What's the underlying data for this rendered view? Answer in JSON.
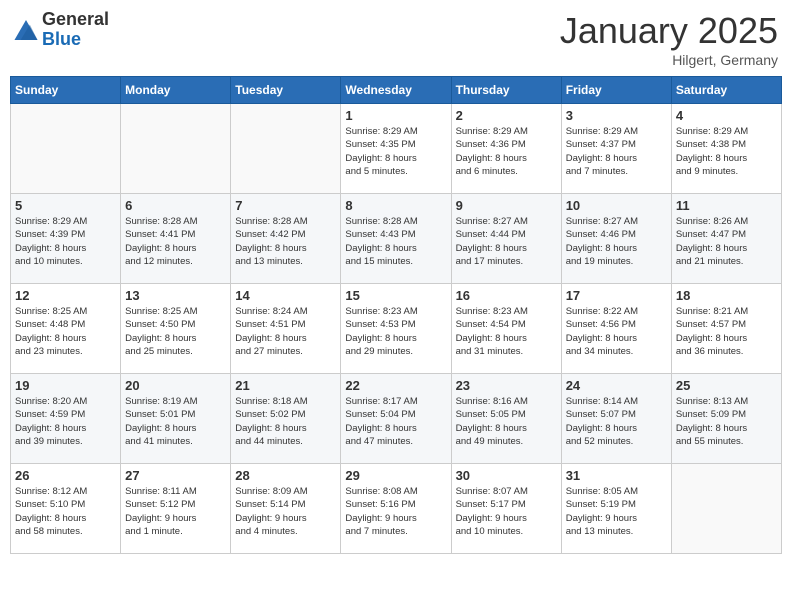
{
  "header": {
    "logo_general": "General",
    "logo_blue": "Blue",
    "month_title": "January 2025",
    "location": "Hilgert, Germany"
  },
  "weekdays": [
    "Sunday",
    "Monday",
    "Tuesday",
    "Wednesday",
    "Thursday",
    "Friday",
    "Saturday"
  ],
  "weeks": [
    [
      {
        "day": "",
        "info": ""
      },
      {
        "day": "",
        "info": ""
      },
      {
        "day": "",
        "info": ""
      },
      {
        "day": "1",
        "info": "Sunrise: 8:29 AM\nSunset: 4:35 PM\nDaylight: 8 hours\nand 5 minutes."
      },
      {
        "day": "2",
        "info": "Sunrise: 8:29 AM\nSunset: 4:36 PM\nDaylight: 8 hours\nand 6 minutes."
      },
      {
        "day": "3",
        "info": "Sunrise: 8:29 AM\nSunset: 4:37 PM\nDaylight: 8 hours\nand 7 minutes."
      },
      {
        "day": "4",
        "info": "Sunrise: 8:29 AM\nSunset: 4:38 PM\nDaylight: 8 hours\nand 9 minutes."
      }
    ],
    [
      {
        "day": "5",
        "info": "Sunrise: 8:29 AM\nSunset: 4:39 PM\nDaylight: 8 hours\nand 10 minutes."
      },
      {
        "day": "6",
        "info": "Sunrise: 8:28 AM\nSunset: 4:41 PM\nDaylight: 8 hours\nand 12 minutes."
      },
      {
        "day": "7",
        "info": "Sunrise: 8:28 AM\nSunset: 4:42 PM\nDaylight: 8 hours\nand 13 minutes."
      },
      {
        "day": "8",
        "info": "Sunrise: 8:28 AM\nSunset: 4:43 PM\nDaylight: 8 hours\nand 15 minutes."
      },
      {
        "day": "9",
        "info": "Sunrise: 8:27 AM\nSunset: 4:44 PM\nDaylight: 8 hours\nand 17 minutes."
      },
      {
        "day": "10",
        "info": "Sunrise: 8:27 AM\nSunset: 4:46 PM\nDaylight: 8 hours\nand 19 minutes."
      },
      {
        "day": "11",
        "info": "Sunrise: 8:26 AM\nSunset: 4:47 PM\nDaylight: 8 hours\nand 21 minutes."
      }
    ],
    [
      {
        "day": "12",
        "info": "Sunrise: 8:25 AM\nSunset: 4:48 PM\nDaylight: 8 hours\nand 23 minutes."
      },
      {
        "day": "13",
        "info": "Sunrise: 8:25 AM\nSunset: 4:50 PM\nDaylight: 8 hours\nand 25 minutes."
      },
      {
        "day": "14",
        "info": "Sunrise: 8:24 AM\nSunset: 4:51 PM\nDaylight: 8 hours\nand 27 minutes."
      },
      {
        "day": "15",
        "info": "Sunrise: 8:23 AM\nSunset: 4:53 PM\nDaylight: 8 hours\nand 29 minutes."
      },
      {
        "day": "16",
        "info": "Sunrise: 8:23 AM\nSunset: 4:54 PM\nDaylight: 8 hours\nand 31 minutes."
      },
      {
        "day": "17",
        "info": "Sunrise: 8:22 AM\nSunset: 4:56 PM\nDaylight: 8 hours\nand 34 minutes."
      },
      {
        "day": "18",
        "info": "Sunrise: 8:21 AM\nSunset: 4:57 PM\nDaylight: 8 hours\nand 36 minutes."
      }
    ],
    [
      {
        "day": "19",
        "info": "Sunrise: 8:20 AM\nSunset: 4:59 PM\nDaylight: 8 hours\nand 39 minutes."
      },
      {
        "day": "20",
        "info": "Sunrise: 8:19 AM\nSunset: 5:01 PM\nDaylight: 8 hours\nand 41 minutes."
      },
      {
        "day": "21",
        "info": "Sunrise: 8:18 AM\nSunset: 5:02 PM\nDaylight: 8 hours\nand 44 minutes."
      },
      {
        "day": "22",
        "info": "Sunrise: 8:17 AM\nSunset: 5:04 PM\nDaylight: 8 hours\nand 47 minutes."
      },
      {
        "day": "23",
        "info": "Sunrise: 8:16 AM\nSunset: 5:05 PM\nDaylight: 8 hours\nand 49 minutes."
      },
      {
        "day": "24",
        "info": "Sunrise: 8:14 AM\nSunset: 5:07 PM\nDaylight: 8 hours\nand 52 minutes."
      },
      {
        "day": "25",
        "info": "Sunrise: 8:13 AM\nSunset: 5:09 PM\nDaylight: 8 hours\nand 55 minutes."
      }
    ],
    [
      {
        "day": "26",
        "info": "Sunrise: 8:12 AM\nSunset: 5:10 PM\nDaylight: 8 hours\nand 58 minutes."
      },
      {
        "day": "27",
        "info": "Sunrise: 8:11 AM\nSunset: 5:12 PM\nDaylight: 9 hours\nand 1 minute."
      },
      {
        "day": "28",
        "info": "Sunrise: 8:09 AM\nSunset: 5:14 PM\nDaylight: 9 hours\nand 4 minutes."
      },
      {
        "day": "29",
        "info": "Sunrise: 8:08 AM\nSunset: 5:16 PM\nDaylight: 9 hours\nand 7 minutes."
      },
      {
        "day": "30",
        "info": "Sunrise: 8:07 AM\nSunset: 5:17 PM\nDaylight: 9 hours\nand 10 minutes."
      },
      {
        "day": "31",
        "info": "Sunrise: 8:05 AM\nSunset: 5:19 PM\nDaylight: 9 hours\nand 13 minutes."
      },
      {
        "day": "",
        "info": ""
      }
    ]
  ]
}
